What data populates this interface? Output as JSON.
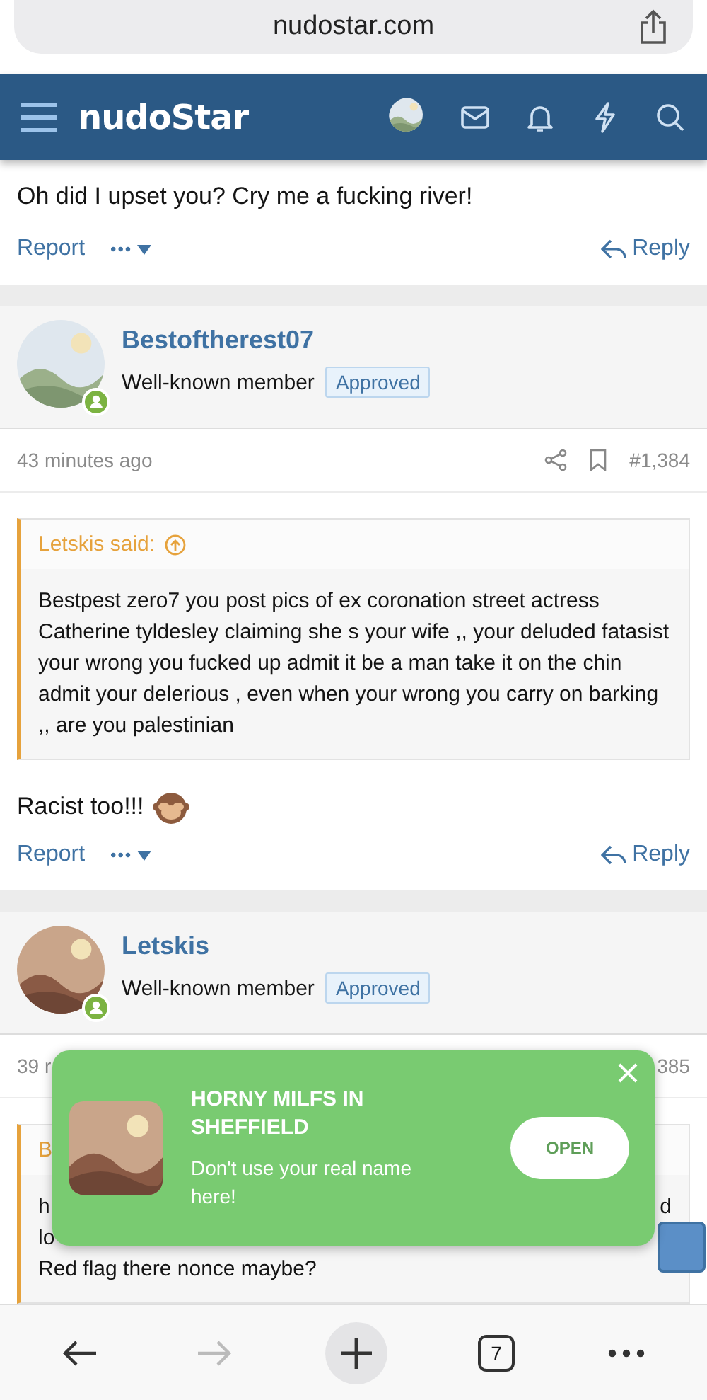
{
  "browser": {
    "url": "nudostar.com",
    "tab_count": "7"
  },
  "header": {
    "logo": "nudoStar"
  },
  "posts": [
    {
      "kind": "tail",
      "message": "Oh did I upset you? Cry me a fucking river!",
      "report": "Report",
      "more": "•••",
      "reply": "Reply"
    },
    {
      "kind": "full",
      "author": "Bestoftherest07",
      "role": "Well-known member",
      "badge": "Approved",
      "online": true,
      "time": "43 minutes ago",
      "number": "#1,384",
      "quote": {
        "author": "Letskis said:",
        "lines": [
          {
            "text": "Bestpest zero7 you post pics of ex coronation street actress Catherine tyldesley claiming she s your wife ,, your deluded fatasist your wrong you fucked up admit it be a man take it on the chin admit your delerious , even when your wrong you carry on barking ,, are you palestinian"
          }
        ]
      },
      "message": "Racist too!!!",
      "report": "Report",
      "more": "•••",
      "reply": "Reply"
    },
    {
      "kind": "full",
      "author": "Letskis",
      "role": "Well-known member",
      "badge": "Approved",
      "online": true,
      "time": "39 r",
      "number": "385",
      "quote": {
        "author": "B",
        "lines": [
          {
            "text": "h",
            "end": "d"
          },
          {
            "text": "lo"
          },
          {
            "text": "Red flag there nonce maybe?"
          }
        ]
      }
    }
  ],
  "popup": {
    "title": "HORNY MILFS IN SHEFFIELD",
    "text": "Don't use your real name here!",
    "button": "OPEN"
  }
}
